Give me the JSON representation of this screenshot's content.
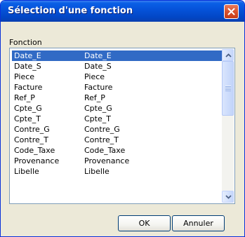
{
  "window": {
    "title": "Sélection d'une fonction",
    "close_icon": "close-icon"
  },
  "list": {
    "label": "Fonction",
    "selected_index": 0,
    "items": [
      {
        "name": "Date_E",
        "value": "Date_E"
      },
      {
        "name": "Date_S",
        "value": "Date_S"
      },
      {
        "name": "Piece",
        "value": "Piece"
      },
      {
        "name": "Facture",
        "value": "Facture"
      },
      {
        "name": "Ref_P",
        "value": "Ref_P"
      },
      {
        "name": "Cpte_G",
        "value": "Cpte_G"
      },
      {
        "name": "Cpte_T",
        "value": "Cpte_T"
      },
      {
        "name": "Contre_G",
        "value": "Contre_G"
      },
      {
        "name": "Contre_T",
        "value": "Contre_T"
      },
      {
        "name": "Code_Taxe",
        "value": "Code_Taxe"
      },
      {
        "name": "Provenance",
        "value": "Provenance"
      },
      {
        "name": "Libelle",
        "value": "Libelle"
      }
    ],
    "scrollbar": {
      "up_icon": "arrow-up-icon",
      "down_icon": "arrow-down-icon",
      "position": 0
    }
  },
  "buttons": {
    "ok": "OK",
    "cancel": "Annuler"
  },
  "colors": {
    "selection": "#316ac5",
    "title_bar": "#0551d8",
    "dialog_background": "#ece9d8",
    "close_button": "#d8512c"
  }
}
